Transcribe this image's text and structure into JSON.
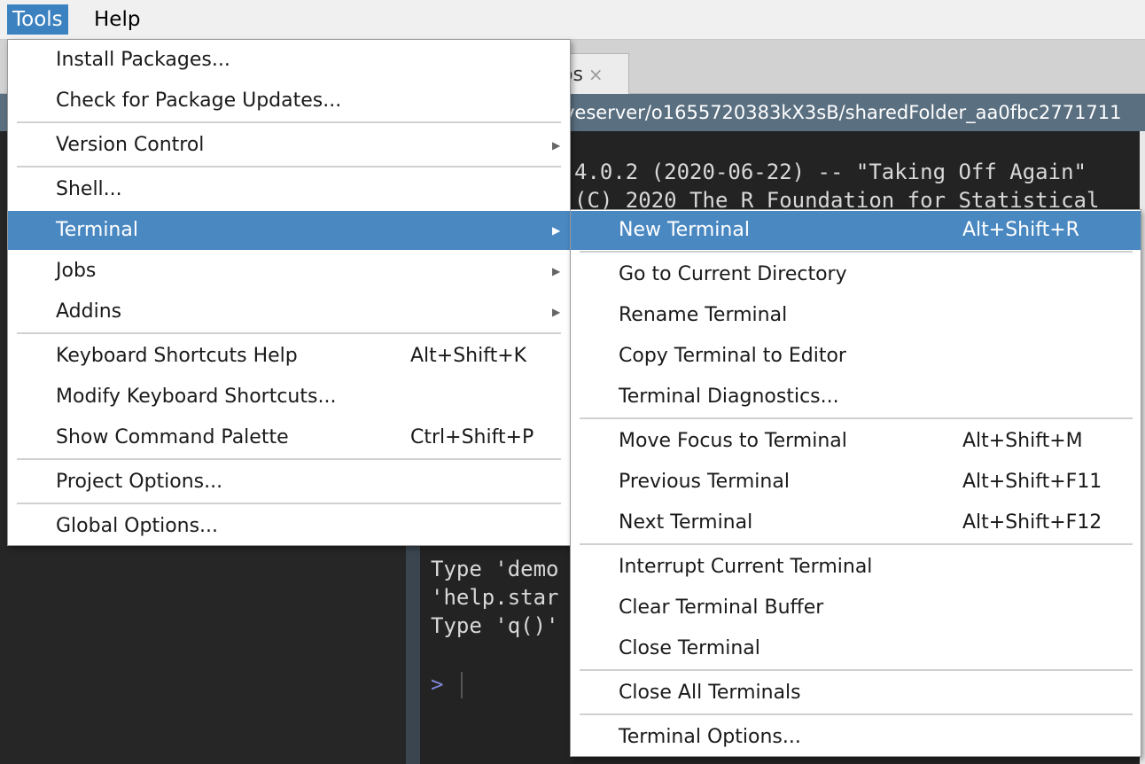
{
  "menubar": {
    "items": [
      "Tools",
      "Help"
    ]
  },
  "background": {
    "tab_label": "os",
    "tab_close": "×",
    "path": "veserver/o1655720383kX3sB/sharedFolder_aa0fbc2771711",
    "console_lines": [
      "4.0.2 (2020-06-22) -- \"Taking Off Again\"",
      "(C) 2020 The R Foundation for Statistical",
      "Type 'demo",
      "'help.star",
      "Type 'q()'"
    ],
    "prompt": ">"
  },
  "tools_menu": {
    "items": [
      {
        "label": "Install Packages...",
        "shortcut": "",
        "submenu": false
      },
      {
        "label": "Check for Package Updates...",
        "shortcut": "",
        "submenu": false
      },
      {
        "label": "Version Control",
        "shortcut": "",
        "submenu": true
      },
      {
        "label": "Shell...",
        "shortcut": "",
        "submenu": false
      },
      {
        "label": "Terminal",
        "shortcut": "",
        "submenu": true,
        "highlighted": true
      },
      {
        "label": "Jobs",
        "shortcut": "",
        "submenu": true
      },
      {
        "label": "Addins",
        "shortcut": "",
        "submenu": true
      },
      {
        "label": "Keyboard Shortcuts Help",
        "shortcut": "Alt+Shift+K",
        "submenu": false
      },
      {
        "label": "Modify Keyboard Shortcuts...",
        "shortcut": "",
        "submenu": false
      },
      {
        "label": "Show Command Palette",
        "shortcut": "Ctrl+Shift+P",
        "submenu": false
      },
      {
        "label": "Project Options...",
        "shortcut": "",
        "submenu": false
      },
      {
        "label": "Global Options...",
        "shortcut": "",
        "submenu": false
      }
    ]
  },
  "terminal_menu": {
    "items": [
      {
        "label": "New Terminal",
        "shortcut": "Alt+Shift+R",
        "highlighted": true
      },
      {
        "label": "Go to Current Directory",
        "shortcut": ""
      },
      {
        "label": "Rename Terminal",
        "shortcut": ""
      },
      {
        "label": "Copy Terminal to Editor",
        "shortcut": ""
      },
      {
        "label": "Terminal Diagnostics...",
        "shortcut": ""
      },
      {
        "label": "Move Focus to Terminal",
        "shortcut": "Alt+Shift+M"
      },
      {
        "label": "Previous Terminal",
        "shortcut": "Alt+Shift+F11"
      },
      {
        "label": "Next Terminal",
        "shortcut": "Alt+Shift+F12"
      },
      {
        "label": "Interrupt Current Terminal",
        "shortcut": ""
      },
      {
        "label": "Clear Terminal Buffer",
        "shortcut": ""
      },
      {
        "label": "Close Terminal",
        "shortcut": ""
      },
      {
        "label": "Close All Terminals",
        "shortcut": ""
      },
      {
        "label": "Terminal Options...",
        "shortcut": ""
      }
    ]
  },
  "colors": {
    "highlight": "#4a88c2",
    "menubar_active": "#3d82c0",
    "console_bg": "#232323",
    "path_bar": "#5a6f80"
  }
}
